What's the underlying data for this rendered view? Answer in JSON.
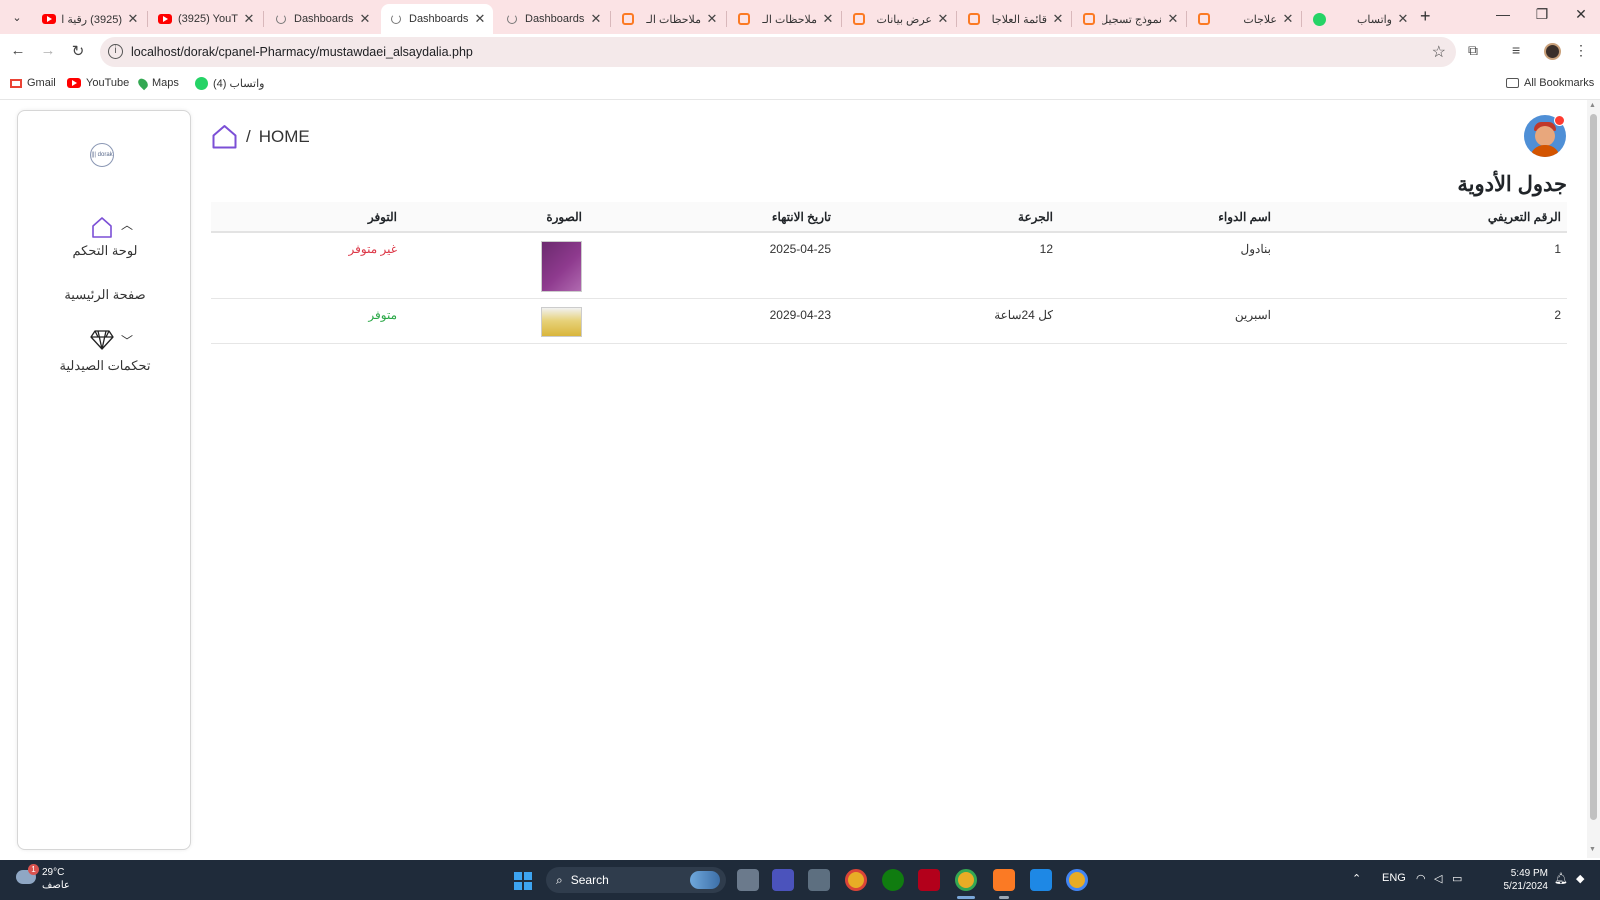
{
  "browser": {
    "tabs": [
      {
        "title": "(3925) رقية ا",
        "icon": "youtube-icon",
        "active": false
      },
      {
        "title": "(3925) YouTu",
        "icon": "youtube-icon",
        "active": false
      },
      {
        "title": "Dashboards",
        "icon": "loading-icon",
        "active": false
      },
      {
        "title": "Dashboards",
        "icon": "loading-icon",
        "active": true
      },
      {
        "title": "Dashboards",
        "icon": "loading-icon",
        "active": false
      },
      {
        "title": "ملاحظات الـ",
        "icon": "xampp-icon",
        "active": false
      },
      {
        "title": "ملاحظات الـ",
        "icon": "xampp-icon",
        "active": false
      },
      {
        "title": "عرض بيانات",
        "icon": "xampp-icon",
        "active": false
      },
      {
        "title": "قائمة العلاجا",
        "icon": "xampp-icon",
        "active": false
      },
      {
        "title": "نموذج تسجيل",
        "icon": "xampp-icon",
        "active": false
      },
      {
        "title": "علاجات",
        "icon": "xampp-icon",
        "active": false
      },
      {
        "title": "واتساب",
        "icon": "whatsapp-icon",
        "active": false
      }
    ],
    "url": "localhost/dorak/cpanel-Pharmacy/mustawdaei_alsaydalia.php",
    "bookmarks": [
      {
        "label": "Gmail",
        "icon": "gmail-icon"
      },
      {
        "label": "YouTube",
        "icon": "youtube-icon"
      },
      {
        "label": "Maps",
        "icon": "maps-icon"
      },
      {
        "label": "واتساب (4)",
        "icon": "whatsapp-icon"
      }
    ],
    "all_bookmarks": "All Bookmarks"
  },
  "sidebar": {
    "logo_text": "||| dorak",
    "items": [
      {
        "label": "لوحة التحكم",
        "icon": "home-icon",
        "chevron": "up"
      },
      {
        "label": "صفحة الرئيسية"
      },
      {
        "label": "تحكمات الصيدلية",
        "icon": "diamond-icon",
        "chevron": "down"
      }
    ]
  },
  "breadcrumb": {
    "separator": "/",
    "label": "HOME"
  },
  "page_title": "جدول الأدوية",
  "table": {
    "columns": [
      "الرقم التعريفي",
      "اسم الدواء",
      "الجرعة",
      "تاريخ الانتهاء",
      "الصورة",
      "التوفر"
    ],
    "rows": [
      {
        "id": "1",
        "name": "بنادول",
        "dose": "12",
        "expiry": "2025-04-25",
        "image": "panadol-thumbnail",
        "availability": "غير متوفر",
        "available": false
      },
      {
        "id": "2",
        "name": "اسبرين",
        "dose": "كل 24ساعة",
        "expiry": "2029-04-23",
        "image": "ampicin-thumbnail",
        "availability": "متوفر",
        "available": true
      }
    ]
  },
  "colors": {
    "accent_purple": "#6f42c1",
    "unavailable": "#dc3545",
    "available": "#28a745",
    "tabbar": "#fbe3e5"
  },
  "taskbar": {
    "weather_temp": "29°C",
    "weather_desc": "عاصف",
    "weather_badge": "1",
    "search_label": "Search",
    "language": "ENG",
    "time": "5:49 PM",
    "date": "5/21/2024"
  }
}
